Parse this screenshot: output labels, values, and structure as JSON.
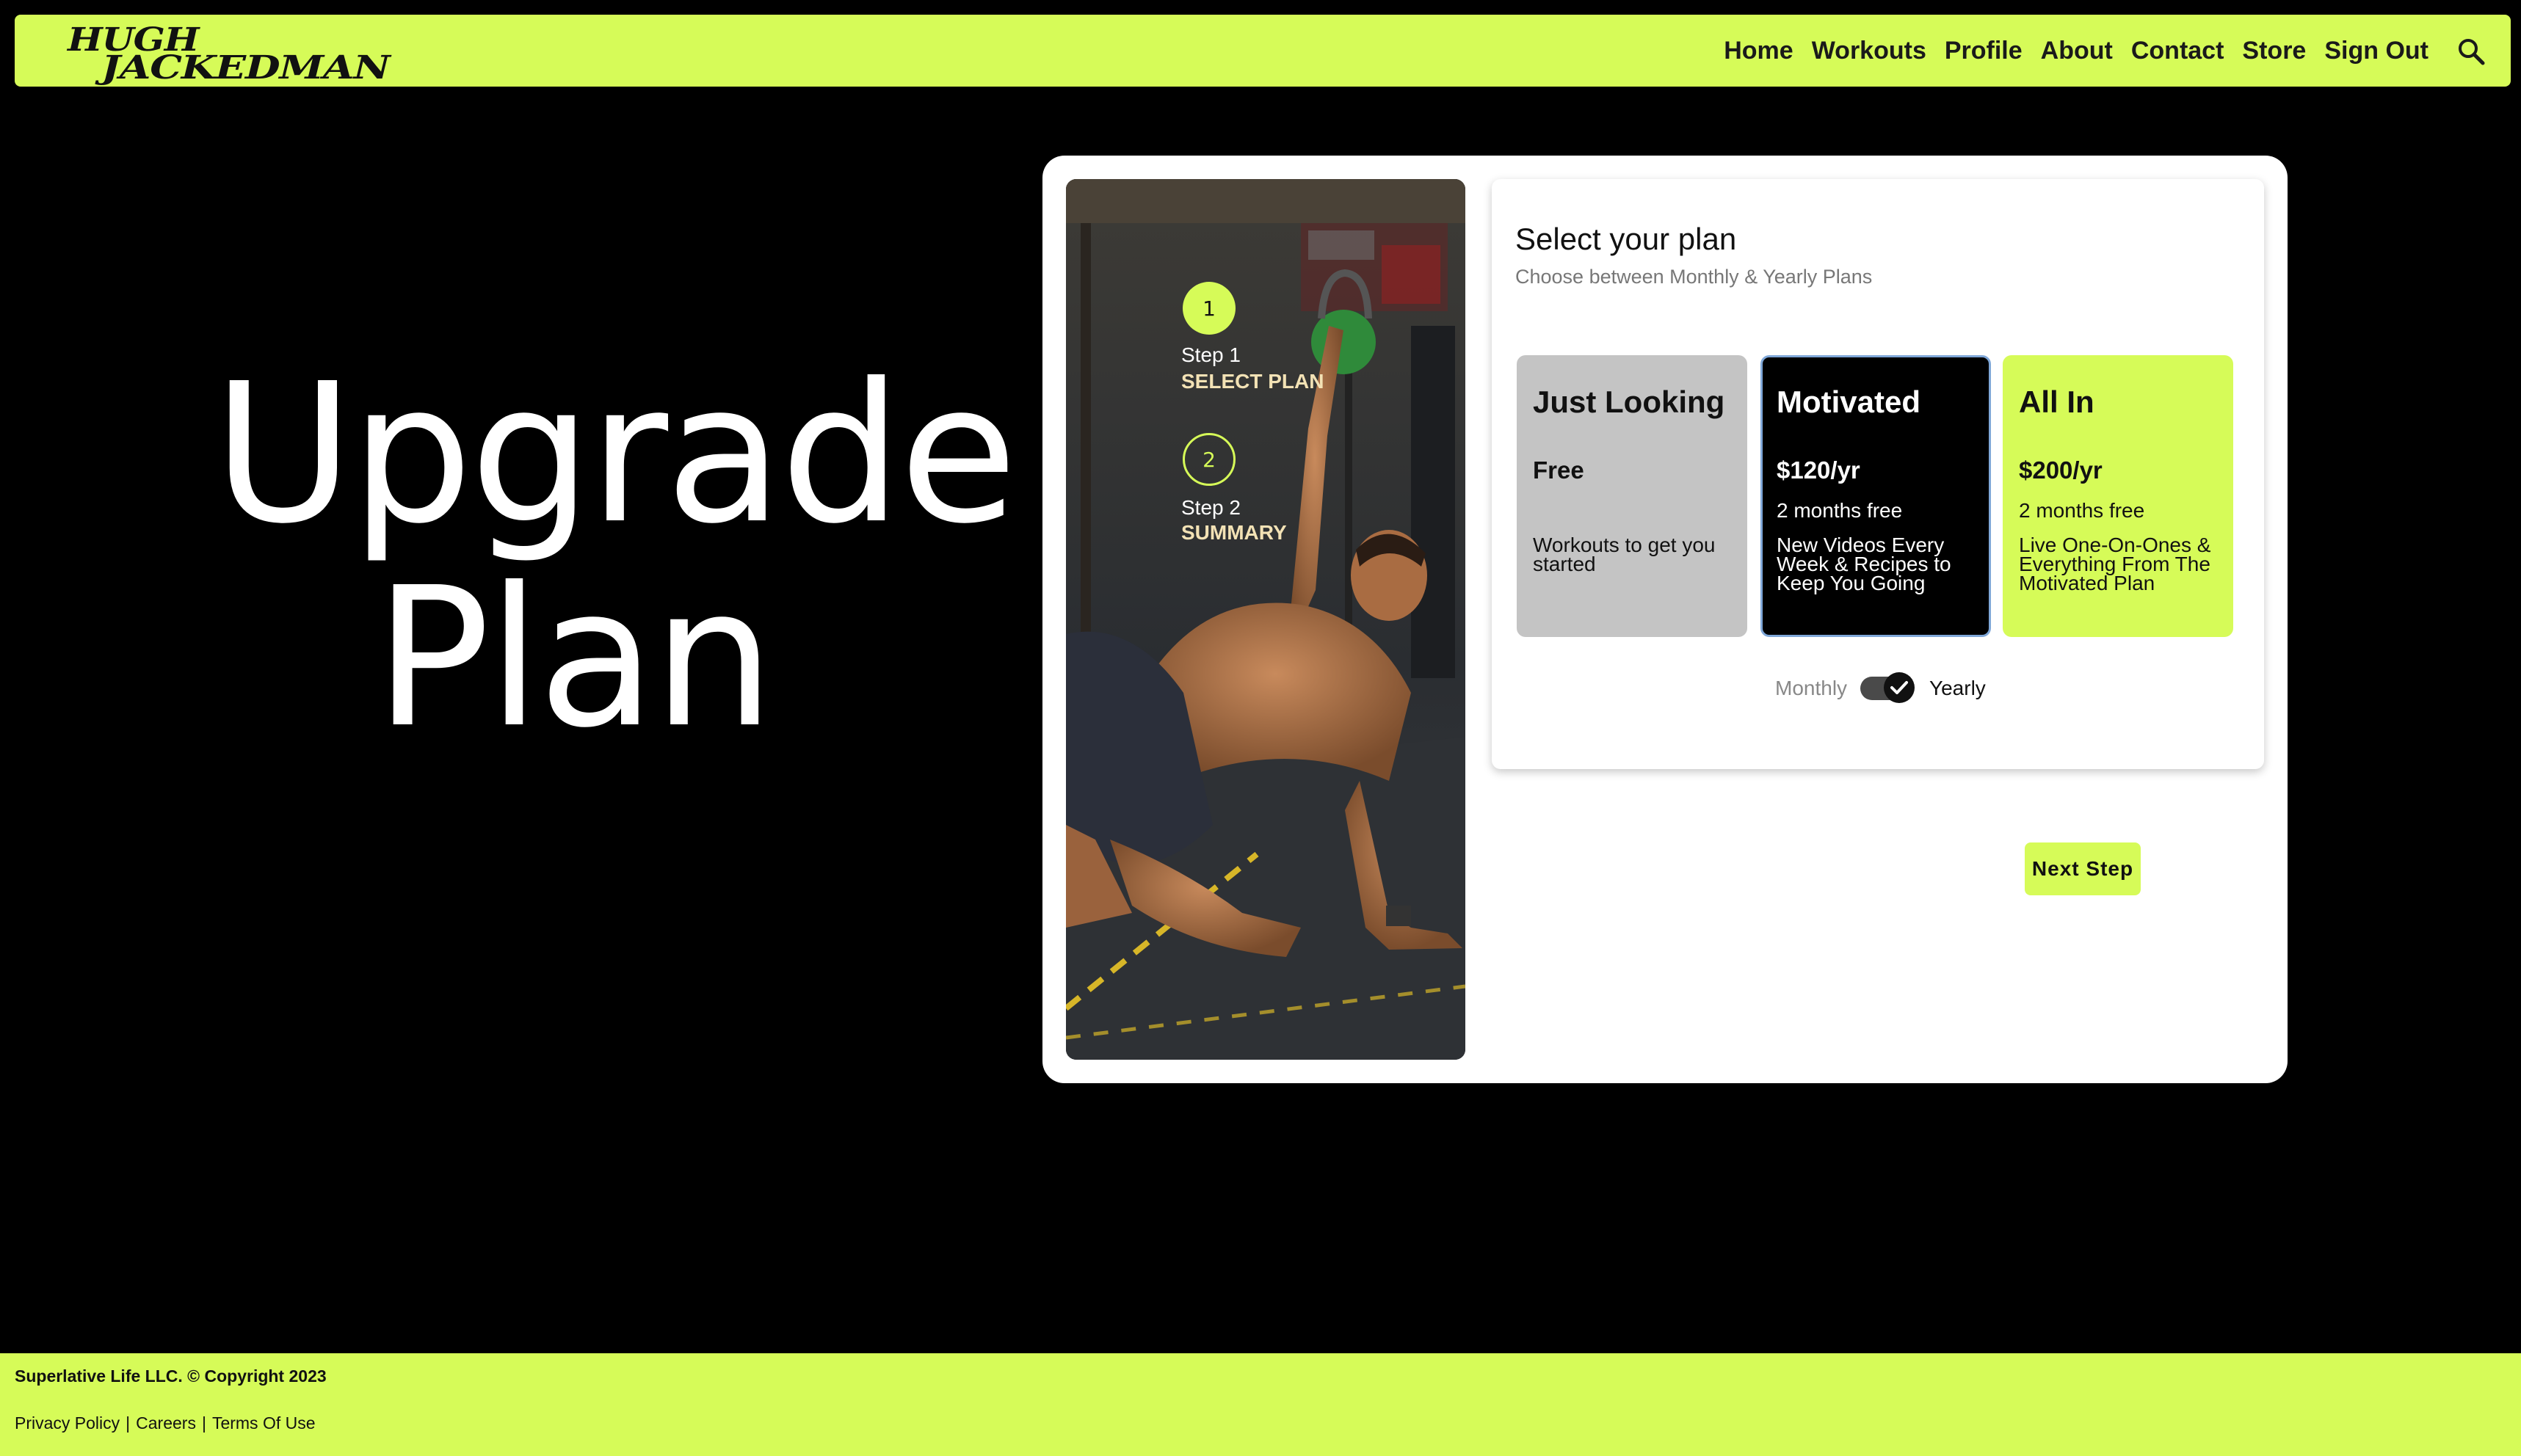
{
  "header": {
    "logo_line1": "HUGH",
    "logo_line2": "JACKEDMAN",
    "nav": {
      "home": "Home",
      "workouts": "Workouts",
      "profile": "Profile",
      "about": "About",
      "contact": "Contact",
      "store": "Store",
      "sign_out": "Sign Out"
    },
    "search_icon": "search-icon"
  },
  "hero": {
    "line1": "Upgrade",
    "line2": "Plan"
  },
  "steps": [
    {
      "number": "1",
      "label": "Step 1",
      "name": "SELECT PLAN",
      "state": "active"
    },
    {
      "number": "2",
      "label": "Step 2",
      "name": "SUMMARY",
      "state": "upcoming"
    }
  ],
  "plan_panel": {
    "title": "Select your plan",
    "subtitle": "Choose between Monthly & Yearly Plans",
    "plans": [
      {
        "name": "Just Looking",
        "price": "Free",
        "bonus": "",
        "description": "Workouts to get you started"
      },
      {
        "name": "Motivated",
        "price": "$120/yr",
        "bonus": "2 months free",
        "description": "New Videos Every Week & Recipes to Keep You Going"
      },
      {
        "name": "All In",
        "price": "$200/yr",
        "bonus": "2 months free",
        "description": "Live One-On-Ones & Everything From The Motivated Plan"
      }
    ],
    "selected_plan": "Motivated",
    "billing_toggle": {
      "left_label": "Monthly",
      "right_label": "Yearly",
      "value": "Yearly"
    }
  },
  "next_button": "Next Step",
  "footer": {
    "copyright": "Superlative Life LLC. © Copyright 2023",
    "links": [
      "Privacy Policy",
      "Careers",
      "Terms Of Use"
    ]
  },
  "colors": {
    "accent": "#d6fb58",
    "background": "#000000",
    "card_gray": "#c4c4c4",
    "selected_border": "#7fa7d8"
  }
}
